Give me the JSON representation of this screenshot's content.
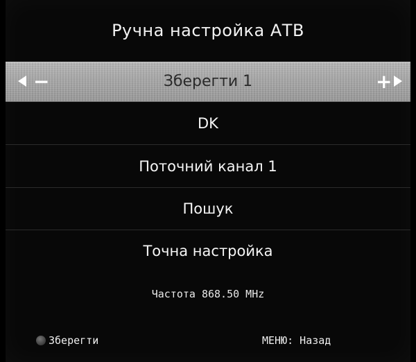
{
  "title": "Ручна настройка АТВ",
  "selected_row": {
    "label": "Зберегти 1",
    "left_arrow_icon": "triangle-left-icon",
    "minus_icon": "minus-icon",
    "plus_icon": "plus-icon",
    "right_arrow_icon": "triangle-right-icon"
  },
  "menu_items": [
    {
      "label": "DK"
    },
    {
      "label": "Поточний канал 1"
    },
    {
      "label": "Пошук"
    },
    {
      "label": "Точна настройка"
    }
  ],
  "frequency": "Частота 868.50 MHz",
  "footer": {
    "save_label": "Зберегти",
    "save_icon": "green-dot-icon",
    "back_label": "МЕНЮ: Назад"
  },
  "colors": {
    "background": "#080808",
    "highlight": "#a8a8a8",
    "text": "#ffffff"
  }
}
